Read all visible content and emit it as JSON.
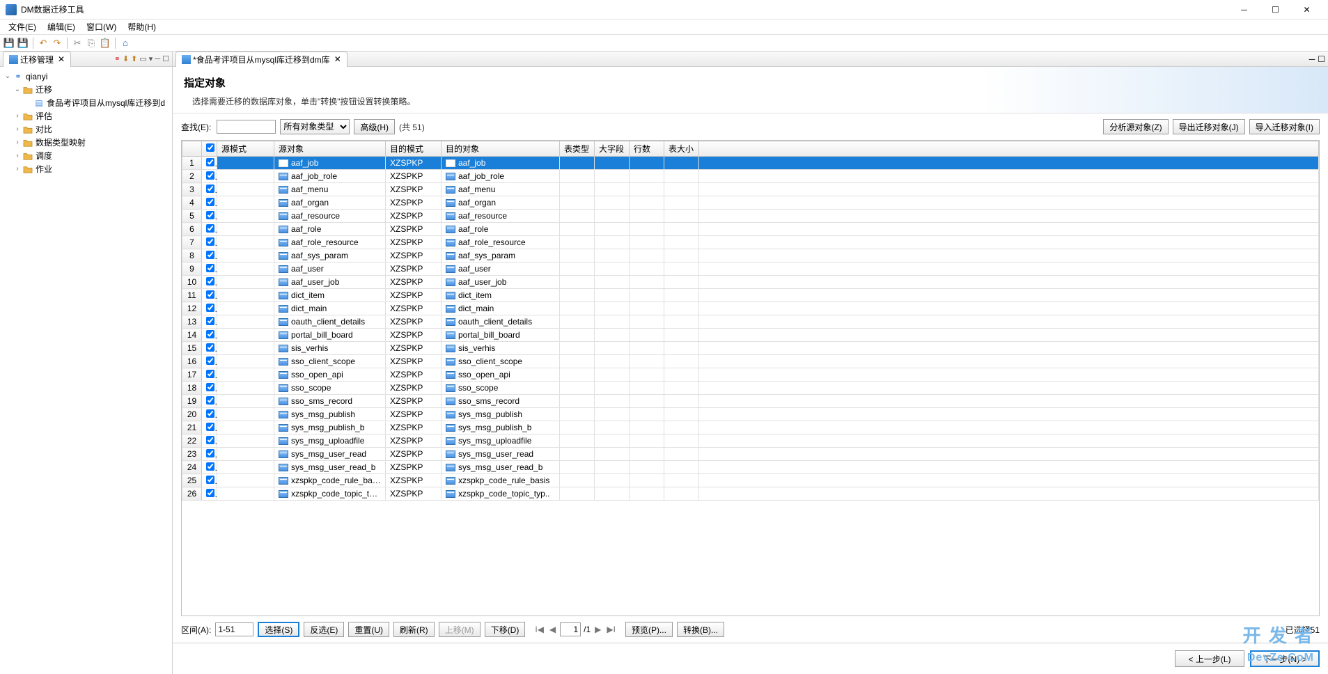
{
  "window": {
    "title": "DM数据迁移工具"
  },
  "menubar": [
    "文件(E)",
    "编辑(E)",
    "窗口(W)",
    "帮助(H)"
  ],
  "sidebar": {
    "tab_title": "迁移管理",
    "tree": {
      "root": "qianyi",
      "children": [
        {
          "label": "迁移",
          "expanded": true,
          "children": [
            {
              "label": "食品考评项目从mysql库迁移到d"
            }
          ]
        },
        {
          "label": "评估"
        },
        {
          "label": "对比"
        },
        {
          "label": "数据类型映射"
        },
        {
          "label": "调度"
        },
        {
          "label": "作业"
        }
      ]
    }
  },
  "editor_tab": "*食品考评项目从mysql库迁移到dm库",
  "page": {
    "title": "指定对象",
    "subtitle": "选择需要迁移的数据库对象，单击\"转换\"按钮设置转换策略。"
  },
  "search": {
    "find_label": "查找(E):",
    "type_label": "所有对象类型",
    "advanced": "高级(H)",
    "count": "(共 51)",
    "analyze": "分析源对象(Z)",
    "export": "导出迁移对象(J)",
    "import": "导入迁移对象(I)"
  },
  "columns": [
    "",
    "",
    "源模式",
    "源对象",
    "目的模式",
    "目的对象",
    "表类型",
    "大字段",
    "行数",
    "表大小",
    ""
  ],
  "dest_schema": "XZSPKP",
  "rows": [
    {
      "n": 1,
      "s": true,
      "obj": "aaf_job"
    },
    {
      "n": 2,
      "obj": "aaf_job_role"
    },
    {
      "n": 3,
      "obj": "aaf_menu"
    },
    {
      "n": 4,
      "obj": "aaf_organ"
    },
    {
      "n": 5,
      "obj": "aaf_resource"
    },
    {
      "n": 6,
      "obj": "aaf_role"
    },
    {
      "n": 7,
      "obj": "aaf_role_resource"
    },
    {
      "n": 8,
      "obj": "aaf_sys_param"
    },
    {
      "n": 9,
      "obj": "aaf_user"
    },
    {
      "n": 10,
      "obj": "aaf_user_job"
    },
    {
      "n": 11,
      "obj": "dict_item"
    },
    {
      "n": 12,
      "obj": "dict_main"
    },
    {
      "n": 13,
      "obj": "oauth_client_details"
    },
    {
      "n": 14,
      "obj": "portal_bill_board"
    },
    {
      "n": 15,
      "obj": "sis_verhis"
    },
    {
      "n": 16,
      "obj": "sso_client_scope"
    },
    {
      "n": 17,
      "obj": "sso_open_api"
    },
    {
      "n": 18,
      "obj": "sso_scope"
    },
    {
      "n": 19,
      "obj": "sso_sms_record"
    },
    {
      "n": 20,
      "obj": "sys_msg_publish"
    },
    {
      "n": 21,
      "obj": "sys_msg_publish_b"
    },
    {
      "n": 22,
      "obj": "sys_msg_uploadfile"
    },
    {
      "n": 23,
      "obj": "sys_msg_user_read"
    },
    {
      "n": 24,
      "obj": "sys_msg_user_read_b"
    },
    {
      "n": 25,
      "obj": "xzspkp_code_rule_basis"
    },
    {
      "n": 26,
      "obj": "xzspkp_code_topic_typ.."
    }
  ],
  "actions": {
    "range_label": "区间(A):",
    "range_value": "1-51",
    "select": "选择(S)",
    "invert": "反选(E)",
    "reset": "重置(U)",
    "refresh": "刷新(R)",
    "moveup": "上移(M)",
    "movedown": "下移(D)",
    "page_current": "1",
    "page_total": "/1",
    "preview": "预览(P)...",
    "convert": "转换(B)...",
    "status": "已选择51"
  },
  "footer": {
    "back": "< 上一步(L)",
    "next": "下一步(N) >"
  },
  "watermark": {
    "line1": "开 发 者",
    "line2": "DevZe.CoM"
  }
}
